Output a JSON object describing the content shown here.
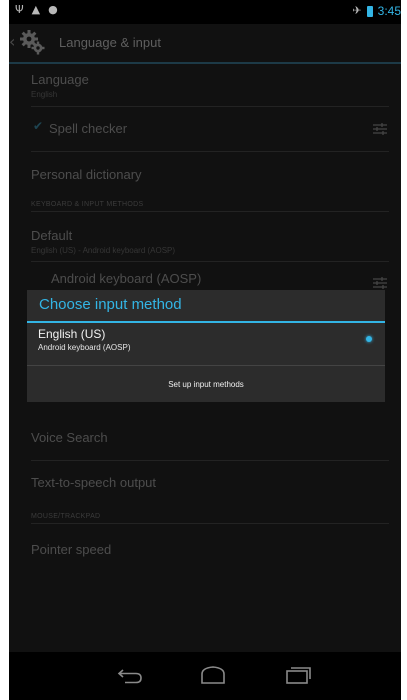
{
  "status_bar": {
    "left_icons": [
      "usb-icon",
      "notification-icon",
      "android-icon"
    ],
    "right_icons": [
      "airplane-icon",
      "battery-icon"
    ],
    "time": "3:45"
  },
  "action_bar": {
    "title": "Language & input",
    "app_icon": "gear-icon"
  },
  "settings": {
    "language": {
      "title": "Language",
      "summary": "English"
    },
    "spell_checker": {
      "title": "Spell checker",
      "checked": true
    },
    "personal_dictionary": {
      "title": "Personal dictionary"
    },
    "section_keyboard": "KEYBOARD & INPUT METHODS",
    "default": {
      "title": "Default",
      "summary": "English (US) - Android keyboard (AOSP)"
    },
    "android_keyboard": {
      "title": "Android keyboard (AOSP)"
    },
    "voice_search": {
      "title": "Voice Search"
    },
    "tts_output": {
      "title": "Text-to-speech output"
    },
    "section_mouse": "MOUSE/TRACKPAD",
    "pointer_speed": {
      "title": "Pointer speed"
    }
  },
  "dialog": {
    "title": "Choose input method",
    "options": [
      {
        "title": "English (US)",
        "subtitle": "Android keyboard (AOSP)",
        "selected": true
      }
    ],
    "button": "Set up input methods"
  },
  "nav_bar": {
    "buttons": [
      "back-icon",
      "home-icon",
      "recent-apps-icon"
    ]
  },
  "colors": {
    "accent": "#33b5e5",
    "dialog_bg": "#2c2c2c",
    "dim_bg": "#111111"
  }
}
